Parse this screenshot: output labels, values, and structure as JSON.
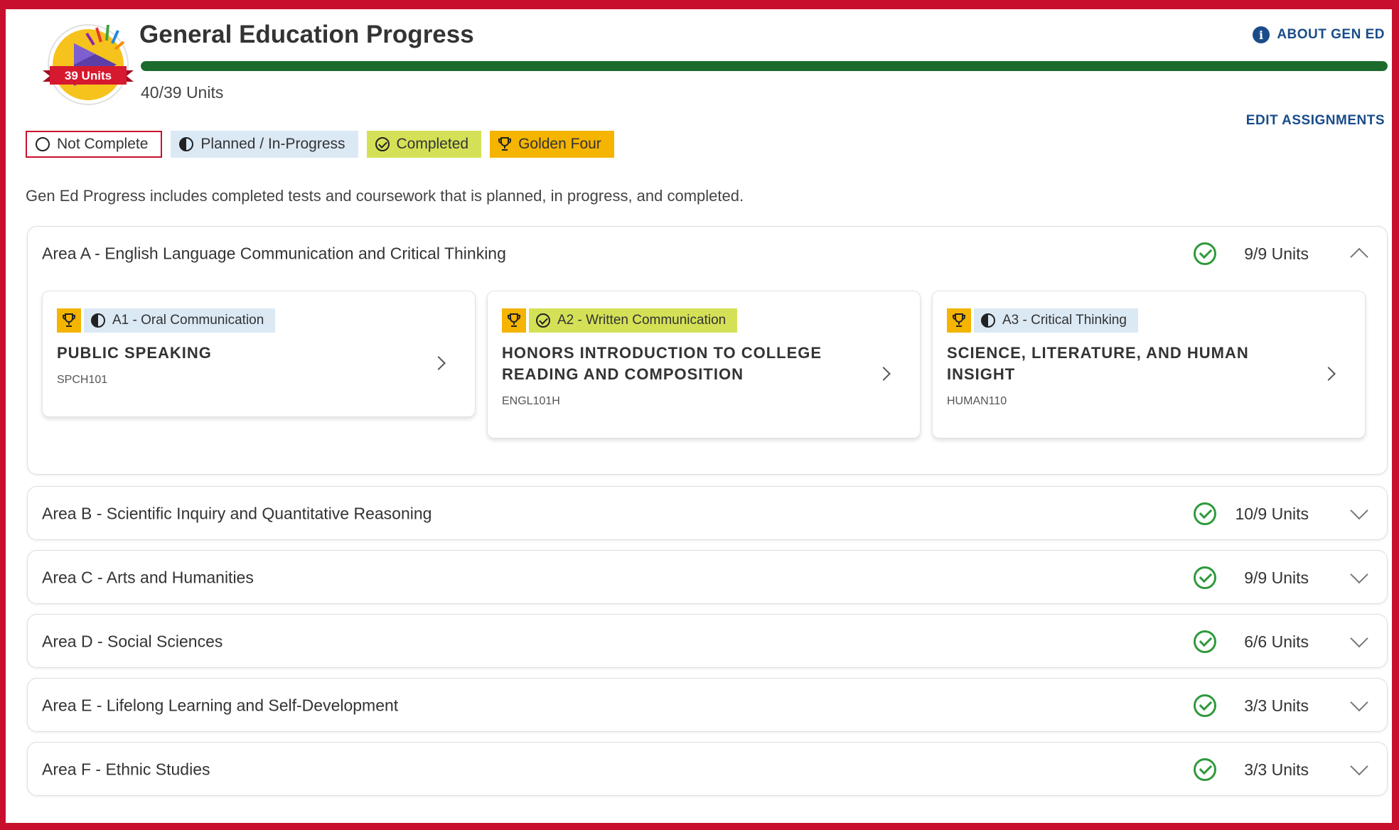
{
  "header": {
    "badge_label": "39 Units",
    "title": "General Education Progress",
    "about_label": "ABOUT GEN ED",
    "progress_text": "40/39 Units",
    "progress_fraction": 1.0,
    "edit_label": "EDIT ASSIGNMENTS"
  },
  "legend": [
    {
      "label": "Not Complete",
      "icon": "empty-circle-icon"
    },
    {
      "label": "Planned / In-Progress",
      "icon": "half-circle-icon"
    },
    {
      "label": "Completed",
      "icon": "check-circle-icon"
    },
    {
      "label": "Golden Four",
      "icon": "trophy-icon"
    }
  ],
  "description": "Gen Ed Progress includes completed tests and coursework that is planned, in progress, and completed.",
  "colors": {
    "frame": "#c8102e",
    "progress": "#1c6b2d",
    "planned": "#dbe9f5",
    "completed": "#d4e157",
    "golden_four": "#f4b400",
    "check": "#2e9a3c",
    "link": "#1a4c8a"
  },
  "areas": [
    {
      "title": "Area A - English Language Communication and Critical Thinking",
      "units": "9/9 Units",
      "expanded": true,
      "courses": [
        {
          "tag": "A1 - Oral Communication",
          "status": "planned",
          "title": "PUBLIC SPEAKING",
          "code": "SPCH101"
        },
        {
          "tag": "A2 - Written Communication",
          "status": "completed",
          "title": "HONORS INTRODUCTION TO COLLEGE READING AND COMPOSITION",
          "code": "ENGL101H"
        },
        {
          "tag": "A3 - Critical Thinking",
          "status": "planned",
          "title": "SCIENCE, LITERATURE, AND HUMAN INSIGHT",
          "code": "HUMAN110"
        }
      ]
    },
    {
      "title": "Area B - Scientific Inquiry and Quantitative Reasoning",
      "units": "10/9 Units",
      "expanded": false
    },
    {
      "title": "Area C - Arts and Humanities",
      "units": "9/9 Units",
      "expanded": false
    },
    {
      "title": "Area D - Social Sciences",
      "units": "6/6 Units",
      "expanded": false
    },
    {
      "title": "Area E - Lifelong Learning and Self-Development",
      "units": "3/3 Units",
      "expanded": false
    },
    {
      "title": "Area F - Ethnic Studies",
      "units": "3/3 Units",
      "expanded": false
    }
  ]
}
